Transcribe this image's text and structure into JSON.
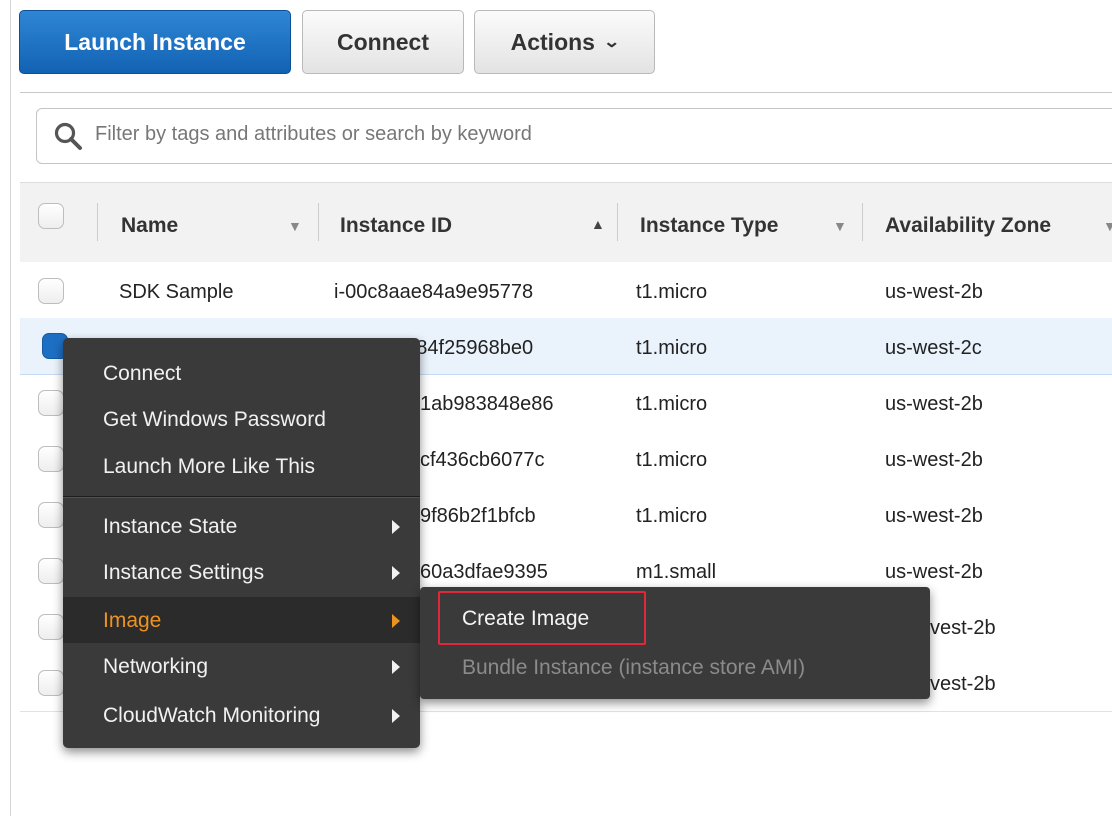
{
  "toolbar": {
    "launch_label": "Launch Instance",
    "connect_label": "Connect",
    "actions_label": "Actions",
    "actions_chevron": "⌄"
  },
  "search": {
    "placeholder": "Filter by tags and attributes or search by keyword"
  },
  "table": {
    "columns": {
      "name": "Name",
      "instance_id": "Instance ID",
      "instance_type": "Instance Type",
      "availability_zone": "Availability Zone"
    },
    "rows": [
      {
        "name": "SDK Sample",
        "instance_id": "i-00c8aae84a9e95778",
        "instance_type": "t1.micro",
        "zone": "us-west-2b",
        "selected": false
      },
      {
        "name": "",
        "instance_id": "i-010__l384f25968be0",
        "instance_type": "t1.micro",
        "zone": "us-west-2c",
        "selected": true
      },
      {
        "name": "",
        "instance_id": "1ab983848e86",
        "instance_type": "t1.micro",
        "zone": "us-west-2b",
        "selected": false
      },
      {
        "name": "",
        "instance_id": "cf436cb6077c",
        "instance_type": "t1.micro",
        "zone": "us-west-2b",
        "selected": false
      },
      {
        "name": "",
        "instance_id": "9f86b2f1bfcb",
        "instance_type": "t1.micro",
        "zone": "us-west-2b",
        "selected": false
      },
      {
        "name": "",
        "instance_id": "60a3dfae9395",
        "instance_type": "m1.small",
        "zone": "us-west-2b",
        "selected": false
      },
      {
        "name": "",
        "instance_id": "",
        "instance_type": "",
        "zone": "vest-2b",
        "selected": false
      },
      {
        "name": "",
        "instance_id": "",
        "instance_type": "",
        "zone": "vest-2b",
        "selected": false
      }
    ]
  },
  "context_menu": {
    "items": [
      {
        "label": "Connect",
        "submenu": false
      },
      {
        "label": "Get Windows Password",
        "submenu": false
      },
      {
        "label": "Launch More Like This",
        "submenu": false
      },
      {
        "label": "Instance State",
        "submenu": true
      },
      {
        "label": "Instance Settings",
        "submenu": true
      },
      {
        "label": "Image",
        "submenu": true,
        "hover": true
      },
      {
        "label": "Networking",
        "submenu": true
      },
      {
        "label": "CloudWatch Monitoring",
        "submenu": true
      }
    ]
  },
  "submenu": {
    "items": [
      {
        "label": "Create Image",
        "enabled": true
      },
      {
        "label": "Bundle Instance (instance store AMI)",
        "enabled": false
      }
    ]
  },
  "colors": {
    "primary": "#1a6fc4",
    "menu_bg": "#3a3a3a",
    "menu_hover_text": "#ec9320",
    "highlight_border": "#e0283a"
  }
}
